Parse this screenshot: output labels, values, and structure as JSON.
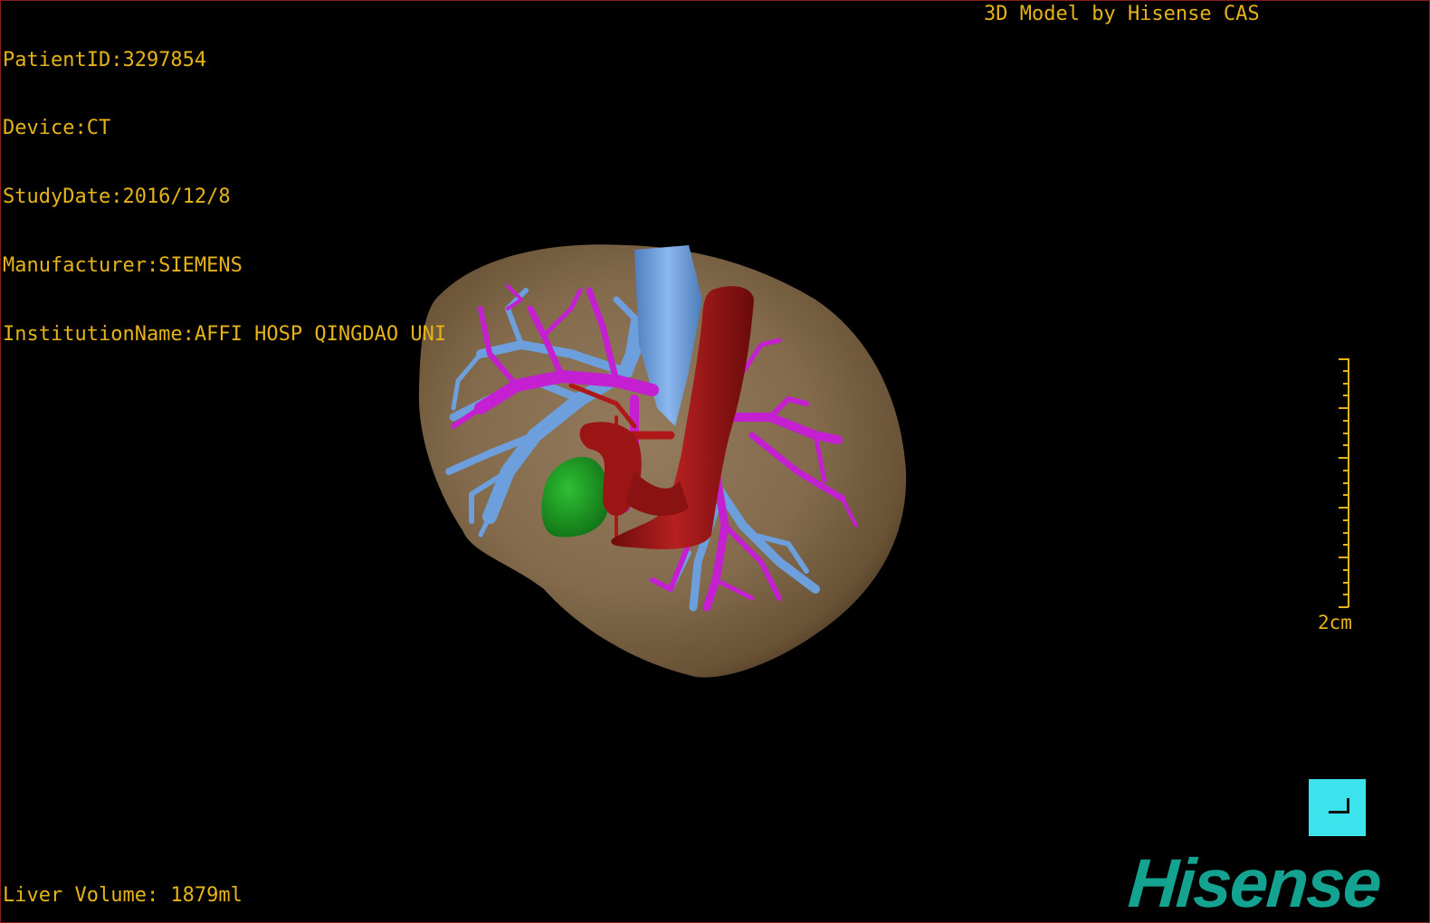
{
  "study_info": {
    "patient_id": "PatientID:3297854",
    "device": "Device:CT",
    "study_date": "StudyDate:2016/12/8",
    "manufacturer": "Manufacturer:SIEMENS",
    "institution": "InstitutionName:AFFI HOSP QINGDAO UNI"
  },
  "credit": "3D Model by Hisense CAS",
  "liver_volume": "Liver Volume: 1879ml",
  "scale": {
    "label": "2cm"
  },
  "logo": {
    "text": "Hisense",
    "color": "#14a391"
  },
  "colors": {
    "text": "#e6b418",
    "liver": "#8a7050",
    "portal_vein": "#c41fd0",
    "hepatic_vein": "#6c9fdc",
    "artery_ivc": "#9c1515",
    "gallbladder": "#1d9a22",
    "reset_button": "#3de3ec",
    "border": "#8a1c1c"
  },
  "model": {
    "structures": [
      "liver",
      "hepatic-vein",
      "portal-vein",
      "inferior-vena-cava",
      "hepatic-artery",
      "gallbladder"
    ]
  },
  "reset_button": {
    "icon": "corner-icon"
  }
}
